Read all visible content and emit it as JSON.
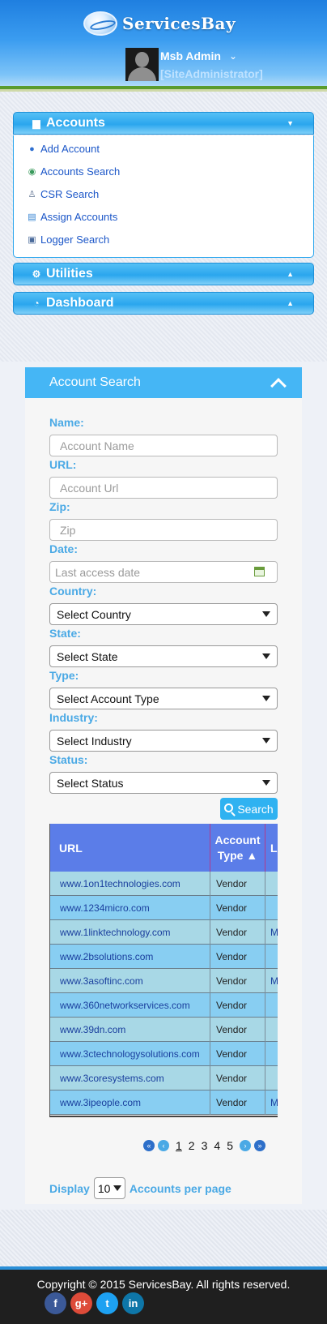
{
  "header": {
    "logo_text": "ServicesBay",
    "user_name": "Msb Admin",
    "user_caret": "⌄",
    "user_role": "[SiteAdministrator]"
  },
  "sidebar": {
    "accounts": {
      "label": "Accounts",
      "items": [
        {
          "label": "Add Account",
          "icon": "add-user-icon"
        },
        {
          "label": "Accounts Search",
          "icon": "globe-search-icon"
        },
        {
          "label": "CSR Search",
          "icon": "person-icon"
        },
        {
          "label": "Assign Accounts",
          "icon": "chart-icon"
        },
        {
          "label": "Logger Search",
          "icon": "document-search-icon"
        }
      ]
    },
    "utilities": {
      "label": "Utilities"
    },
    "dashboard": {
      "label": "Dashboard"
    }
  },
  "search": {
    "title": "Account Search",
    "fields": {
      "name": {
        "label": "Name:",
        "placeholder": "Account Name"
      },
      "url": {
        "label": "URL:",
        "placeholder": "Account Url"
      },
      "zip": {
        "label": "Zip:",
        "placeholder": "Zip"
      },
      "date": {
        "label": "Date:",
        "placeholder": "Last access date"
      },
      "country": {
        "label": "Country:",
        "value": "Select Country"
      },
      "state": {
        "label": "State:",
        "value": "Select State"
      },
      "type": {
        "label": "Type:",
        "value": "Select Account Type"
      },
      "industry": {
        "label": "Industry:",
        "value": "Select Industry"
      },
      "status": {
        "label": "Status:",
        "value": "Select Status"
      }
    },
    "search_button": "Search"
  },
  "table": {
    "headers": {
      "url": "URL",
      "type_line1": "Account",
      "type_line2": "Type ▲",
      "third": "L"
    },
    "rows": [
      {
        "url": "www.1on1technologies.com",
        "type": "Vendor",
        "extra": ""
      },
      {
        "url": "www.1234micro.com",
        "type": "Vendor",
        "extra": ""
      },
      {
        "url": "www.1linktechnology.com",
        "type": "Vendor",
        "extra": "M"
      },
      {
        "url": "www.2bsolutions.com",
        "type": "Vendor",
        "extra": ""
      },
      {
        "url": "www.3asoftinc.com",
        "type": "Vendor",
        "extra": "M"
      },
      {
        "url": "www.360networkservices.com",
        "type": "Vendor",
        "extra": ""
      },
      {
        "url": "www.39dn.com",
        "type": "Vendor",
        "extra": ""
      },
      {
        "url": "www.3ctechnologysolutions.com",
        "type": "Vendor",
        "extra": ""
      },
      {
        "url": "www.3coresystems.com",
        "type": "Vendor",
        "extra": ""
      },
      {
        "url": "www.3ipeople.com",
        "type": "Vendor",
        "extra": "M"
      }
    ]
  },
  "pagination": {
    "first": "«",
    "prev": "‹",
    "next": "›",
    "last": "»",
    "pages": [
      "1",
      "2",
      "3",
      "4",
      "5"
    ],
    "current": "1"
  },
  "display": {
    "prefix": "Display",
    "value": "10",
    "suffix": "Accounts per page"
  },
  "footer": {
    "copyright": "Copyright © 2015 ServicesBay. All rights reserved.",
    "social": [
      {
        "label": "f",
        "icon": "facebook-icon",
        "color": "#3b5998"
      },
      {
        "label": "g+",
        "icon": "google-plus-icon",
        "color": "#dd4b39"
      },
      {
        "label": "t",
        "icon": "twitter-icon",
        "color": "#1da1f2"
      },
      {
        "label": "in",
        "icon": "linkedin-icon",
        "color": "#0e76a8"
      }
    ]
  },
  "colors": {
    "accent": "#45b6f5",
    "link": "#1c57c8",
    "label": "#4aa9e5",
    "table_header": "#5b7de8"
  }
}
